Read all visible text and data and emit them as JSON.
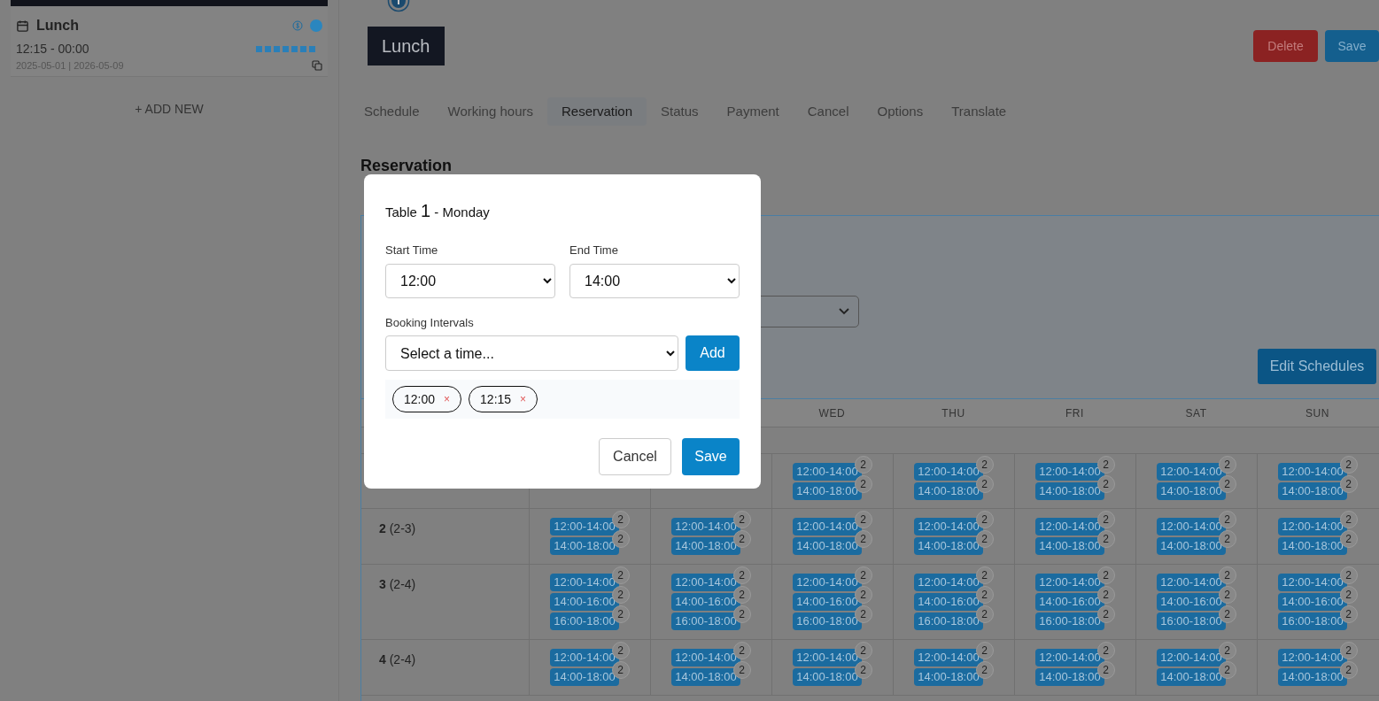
{
  "sidebar": {
    "card": {
      "title": "Lunch",
      "time": "12:15 - 00:00",
      "dates": "2025-05-01 | 2026-05-09",
      "weekdays": [
        true,
        true,
        true,
        true,
        true,
        true,
        true
      ]
    },
    "add_new": "+ ADD NEW"
  },
  "header": {
    "title": "Lunch",
    "buttons": [
      {
        "label": "Delete",
        "kind": "danger"
      },
      {
        "label": "Save",
        "kind": "primary"
      }
    ]
  },
  "tabs": [
    {
      "label": "Schedule",
      "selected": false
    },
    {
      "label": "Working hours",
      "selected": false
    },
    {
      "label": "Reservation",
      "selected": true
    },
    {
      "label": "Status",
      "selected": false
    },
    {
      "label": "Payment",
      "selected": false
    },
    {
      "label": "Cancel",
      "selected": false
    },
    {
      "label": "Options",
      "selected": false
    },
    {
      "label": "Translate",
      "selected": false
    }
  ],
  "section_title": "Reservation",
  "edit_button": "Edit Schedules",
  "schedule_table": {
    "columns": [
      "",
      "",
      "WED",
      "THU",
      "FRI",
      "SAT",
      "SUN"
    ],
    "rows": [
      {
        "cells": [
          [],
          [],
          [
            {
              "time": "12:00-14:00",
              "count": "2"
            },
            {
              "time": "14:00-18:00",
              "count": "2"
            }
          ],
          [
            {
              "time": "12:00-14:00",
              "count": "2"
            },
            {
              "time": "14:00-18:00",
              "count": "2"
            }
          ],
          [
            {
              "time": "12:00-14:00",
              "count": "2"
            },
            {
              "time": "14:00-18:00",
              "count": "2"
            }
          ],
          [
            {
              "time": "12:00-14:00",
              "count": "2"
            },
            {
              "time": "14:00-18:00",
              "count": "2"
            }
          ],
          [
            {
              "time": "12:00-14:00",
              "count": "2"
            },
            {
              "time": "14:00-18:00",
              "count": "2"
            }
          ]
        ]
      },
      {
        "table": "2",
        "capacity": "(2-3)",
        "cells": [
          [
            {
              "time": "12:00-14:00",
              "count": "2"
            },
            {
              "time": "14:00-18:00",
              "count": "2"
            }
          ],
          [
            {
              "time": "12:00-14:00",
              "count": "2"
            },
            {
              "time": "14:00-18:00",
              "count": "2"
            }
          ],
          [
            {
              "time": "12:00-14:00",
              "count": "2"
            },
            {
              "time": "14:00-18:00",
              "count": "2"
            }
          ],
          [
            {
              "time": "12:00-14:00",
              "count": "2"
            },
            {
              "time": "14:00-18:00",
              "count": "2"
            }
          ],
          [
            {
              "time": "12:00-14:00",
              "count": "2"
            },
            {
              "time": "14:00-18:00",
              "count": "2"
            }
          ],
          [
            {
              "time": "12:00-14:00",
              "count": "2"
            },
            {
              "time": "14:00-18:00",
              "count": "2"
            }
          ],
          [
            {
              "time": "12:00-14:00",
              "count": "2"
            },
            {
              "time": "14:00-18:00",
              "count": "2"
            }
          ]
        ]
      },
      {
        "table": "3",
        "capacity": "(2-4)",
        "cells": [
          [
            {
              "time": "12:00-14:00",
              "count": "2"
            },
            {
              "time": "14:00-16:00",
              "count": "2"
            },
            {
              "time": "16:00-18:00",
              "count": "2"
            }
          ],
          [
            {
              "time": "12:00-14:00",
              "count": "2"
            },
            {
              "time": "14:00-16:00",
              "count": "2"
            },
            {
              "time": "16:00-18:00",
              "count": "2"
            }
          ],
          [
            {
              "time": "12:00-14:00",
              "count": "2"
            },
            {
              "time": "14:00-16:00",
              "count": "2"
            },
            {
              "time": "16:00-18:00",
              "count": "2"
            }
          ],
          [
            {
              "time": "12:00-14:00",
              "count": "2"
            },
            {
              "time": "14:00-16:00",
              "count": "2"
            },
            {
              "time": "16:00-18:00",
              "count": "2"
            }
          ],
          [
            {
              "time": "12:00-14:00",
              "count": "2"
            },
            {
              "time": "14:00-16:00",
              "count": "2"
            },
            {
              "time": "16:00-18:00",
              "count": "2"
            }
          ],
          [
            {
              "time": "12:00-14:00",
              "count": "2"
            },
            {
              "time": "14:00-16:00",
              "count": "2"
            },
            {
              "time": "16:00-18:00",
              "count": "2"
            }
          ],
          [
            {
              "time": "12:00-14:00",
              "count": "2"
            },
            {
              "time": "14:00-16:00",
              "count": "2"
            },
            {
              "time": "16:00-18:00",
              "count": "2"
            }
          ]
        ]
      },
      {
        "table": "4",
        "capacity": "(2-4)",
        "cells": [
          [
            {
              "time": "12:00-14:00",
              "count": "2"
            },
            {
              "time": "14:00-18:00",
              "count": "2"
            }
          ],
          [
            {
              "time": "12:00-14:00",
              "count": "2"
            },
            {
              "time": "14:00-18:00",
              "count": "2"
            }
          ],
          [
            {
              "time": "12:00-14:00",
              "count": "2"
            },
            {
              "time": "14:00-18:00",
              "count": "2"
            }
          ],
          [
            {
              "time": "12:00-14:00",
              "count": "2"
            },
            {
              "time": "14:00-18:00",
              "count": "2"
            }
          ],
          [
            {
              "time": "12:00-14:00",
              "count": "2"
            },
            {
              "time": "14:00-18:00",
              "count": "2"
            }
          ],
          [
            {
              "time": "12:00-14:00",
              "count": "2"
            },
            {
              "time": "14:00-18:00",
              "count": "2"
            }
          ],
          [
            {
              "time": "12:00-14:00",
              "count": "2"
            },
            {
              "time": "14:00-18:00",
              "count": "2"
            }
          ]
        ]
      }
    ]
  },
  "modal": {
    "title": "Table **1** - Monday",
    "start_label": "Start Time",
    "start_value": "12:00",
    "end_label": "End Time",
    "end_value": "14:00",
    "intervals_label": "Booking Intervals",
    "intervals_placeholder": "Select a time...",
    "add": "Add",
    "intervals": [
      "12:00",
      "12:15"
    ],
    "remove": "×",
    "cancel": "Cancel",
    "save": "Save"
  }
}
